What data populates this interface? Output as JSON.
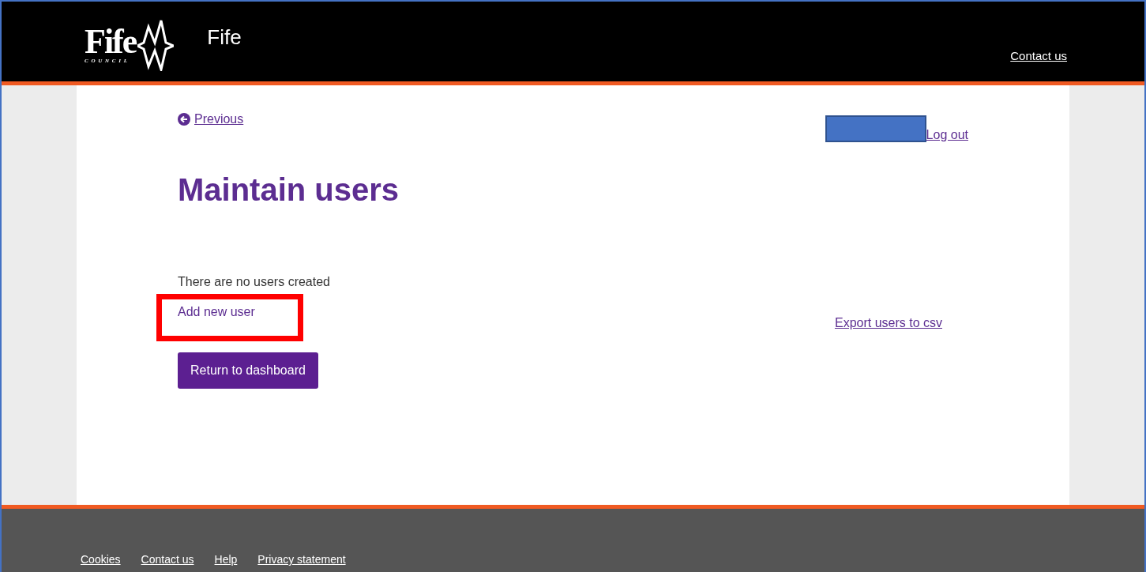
{
  "header": {
    "logo": {
      "word": "Fife",
      "subtitle": "C O U N C I L"
    },
    "site_name": "Fife",
    "contact_link": "Contact us"
  },
  "nav": {
    "previous": "Previous",
    "logout": "Log out"
  },
  "page": {
    "title": "Maintain users",
    "message": "There are no users created",
    "add_link": "Add new user",
    "add_link_highlighted": true,
    "export_link": "Export users to csv",
    "return_button": "Return to dashboard"
  },
  "footer": {
    "links": [
      "Cookies",
      "Contact us",
      "Help",
      "Privacy statement"
    ]
  }
}
